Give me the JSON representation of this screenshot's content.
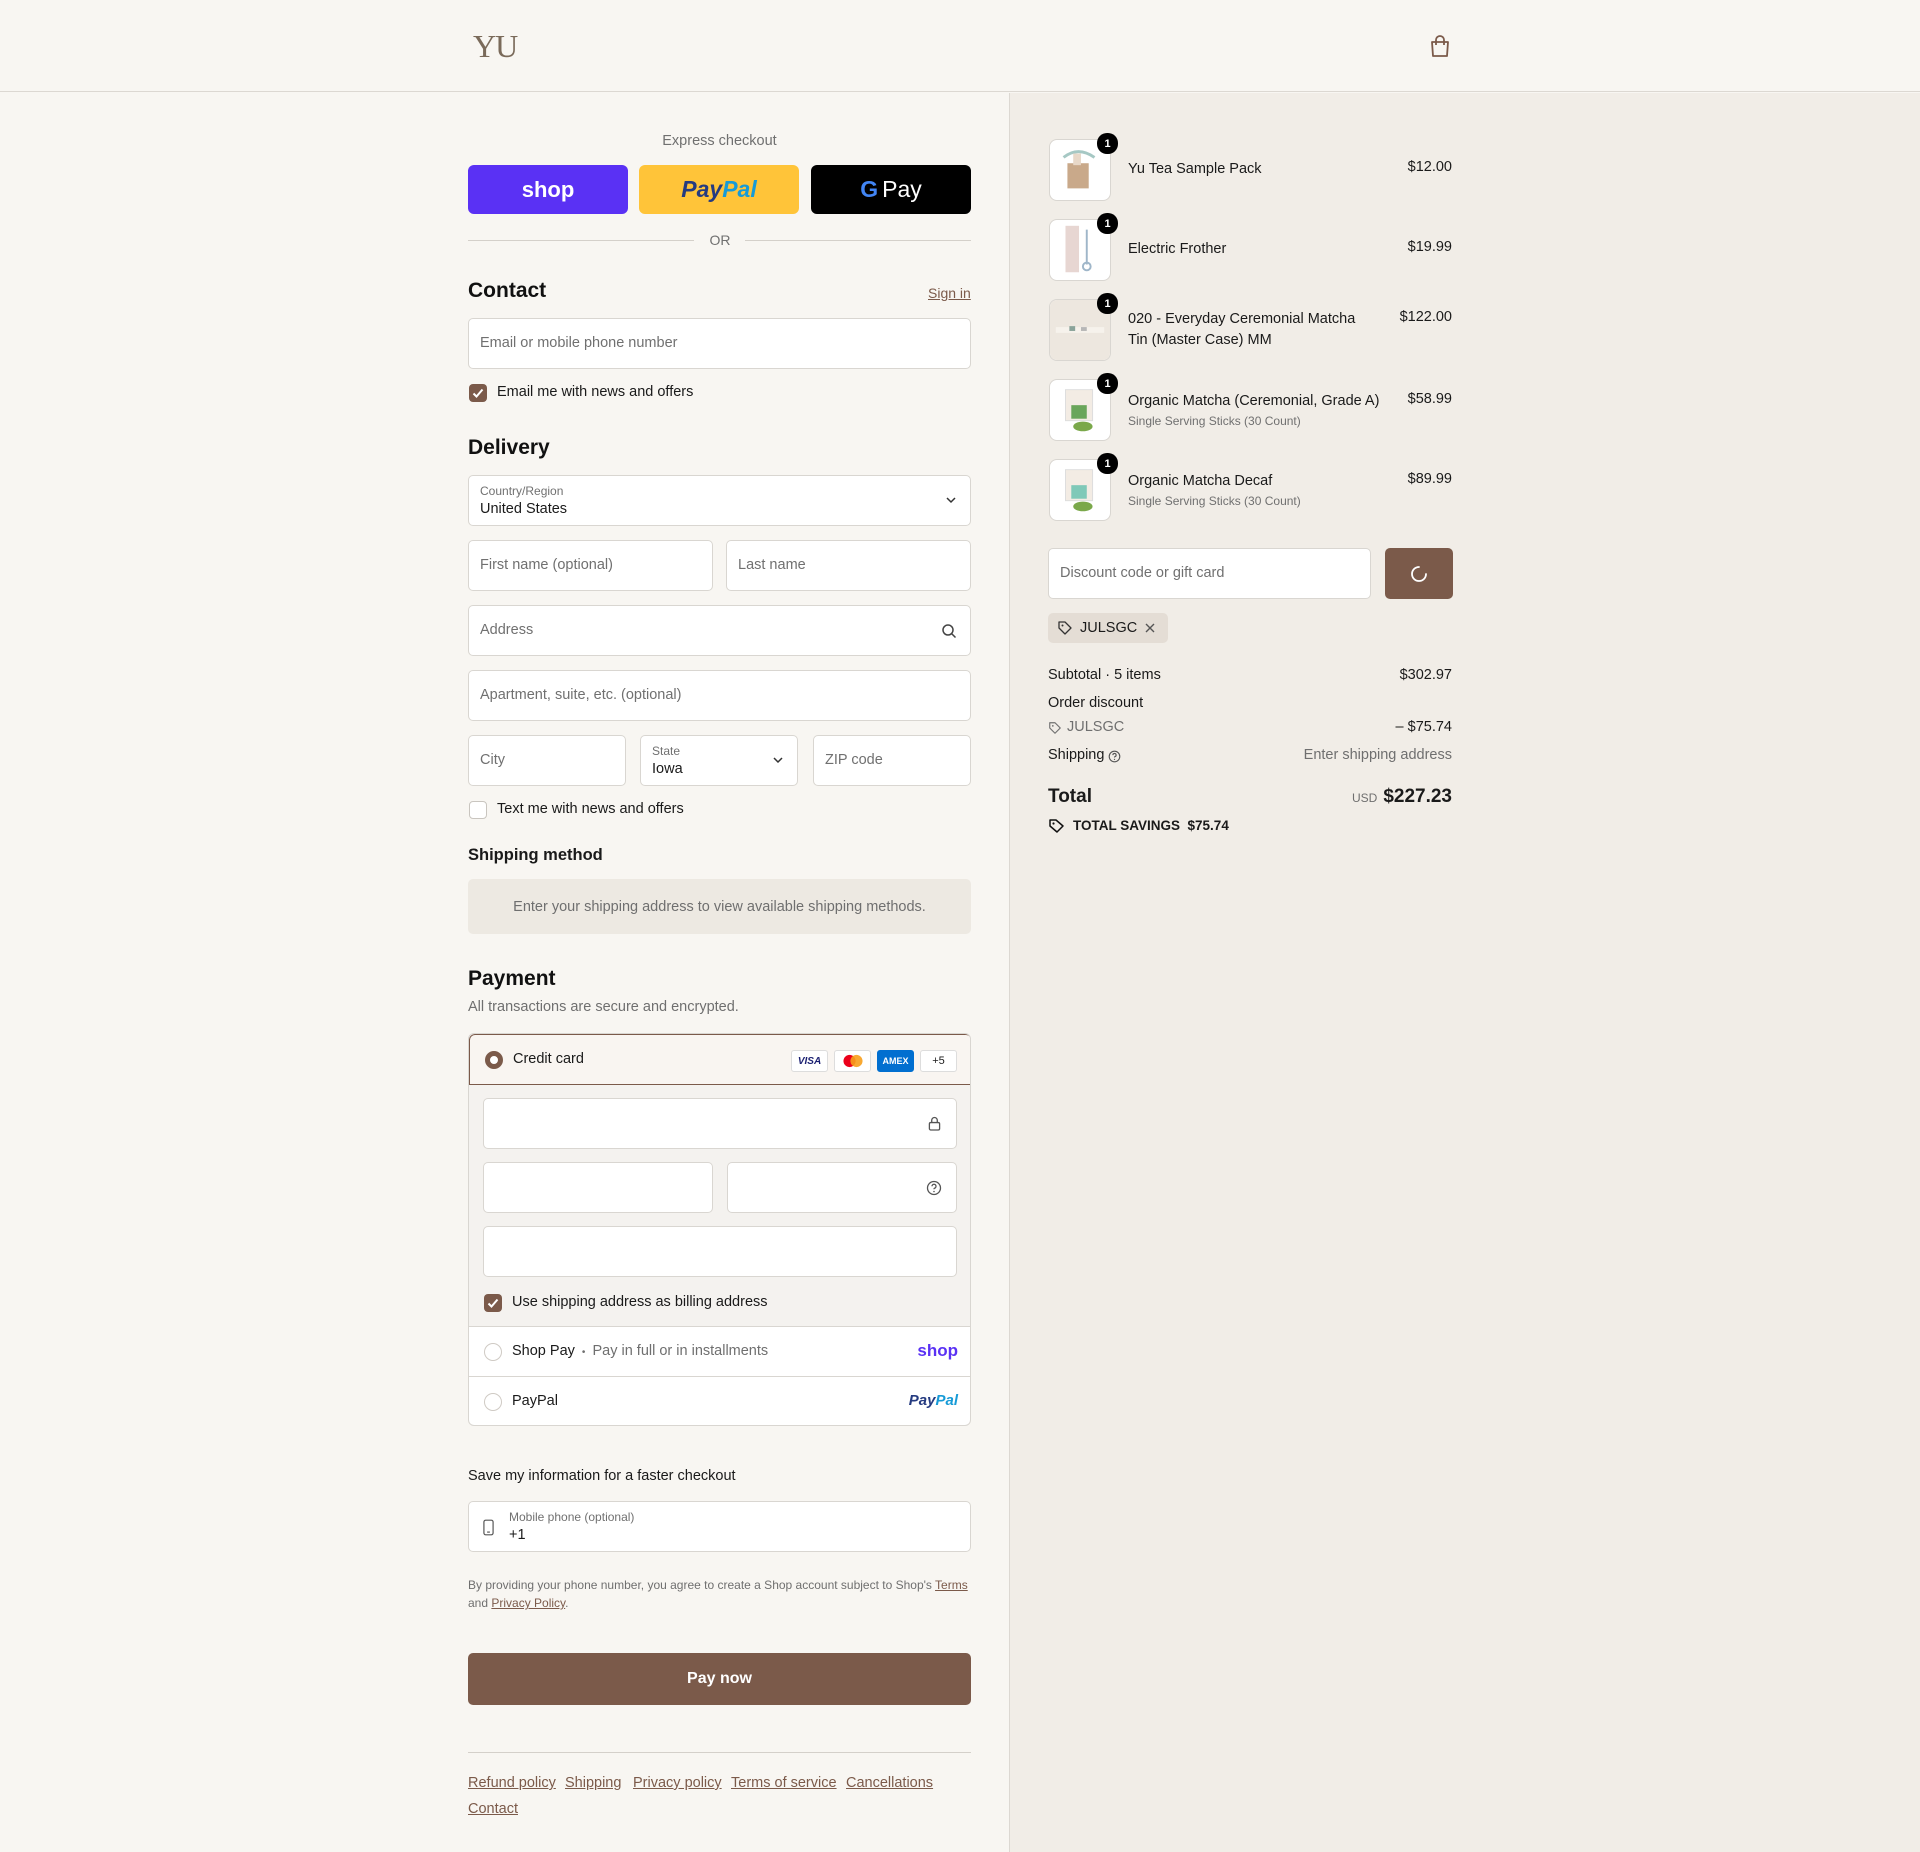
{
  "brand": {
    "logo": "YU"
  },
  "express": {
    "title": "Express checkout",
    "shop": "shop",
    "paypal_a": "Pay",
    "paypal_b": "Pal",
    "gpay_g": "G",
    "gpay_pay": "Pay",
    "or": "OR"
  },
  "contact": {
    "title": "Contact",
    "sign_in": "Sign in",
    "email_placeholder": "Email or mobile phone number",
    "news_label": "Email me with news and offers"
  },
  "delivery": {
    "title": "Delivery",
    "country_label": "Country/Region",
    "country_value": "United States",
    "first_name": "First name (optional)",
    "last_name": "Last name",
    "address": "Address",
    "apartment": "Apartment, suite, etc. (optional)",
    "city": "City",
    "state_label": "State",
    "state_value": "Iowa",
    "zip": "ZIP code",
    "text_news": "Text me with news and offers"
  },
  "shipping_method": {
    "title": "Shipping method",
    "notice": "Enter your shipping address to view available shipping methods."
  },
  "payment": {
    "title": "Payment",
    "subtitle": "All transactions are secure and encrypted.",
    "credit_card": "Credit card",
    "visa": "VISA",
    "amex": "AMEX",
    "more_cards": "+5",
    "billing_same": "Use shipping address as billing address",
    "shop_pay": "Shop Pay",
    "shop_pay_sep": "•",
    "shop_pay_desc": "Pay in full or in installments",
    "shop_logo": "shop",
    "paypal": "PayPal",
    "paypal_logo_a": "Pay",
    "paypal_logo_b": "Pal"
  },
  "save_info": {
    "title": "Save my information for a faster checkout",
    "phone_label": "Mobile phone (optional)",
    "phone_value": "+1",
    "legal_1": "By providing your phone number, you agree to create a Shop account subject to Shop's",
    "terms": "Terms",
    "legal_and": "and",
    "privacy": "Privacy Policy",
    "legal_end": "."
  },
  "pay_now": "Pay now",
  "footer_links": [
    "Refund policy",
    "Shipping",
    "Privacy policy",
    "Terms of service",
    "Cancellations",
    "Contact"
  ],
  "order": {
    "items": [
      {
        "name": "Yu Tea Sample Pack",
        "sub": "",
        "price": "$12.00",
        "qty": "1"
      },
      {
        "name": "Electric Frother",
        "sub": "",
        "price": "$19.99",
        "qty": "1"
      },
      {
        "name": "020 - Everyday Ceremonial Matcha Tin (Master Case) MM",
        "sub": "",
        "price": "$122.00",
        "qty": "1"
      },
      {
        "name": "Organic Matcha (Ceremonial, Grade A)",
        "sub": "Single Serving Sticks (30 Count)",
        "price": "$58.99",
        "qty": "1"
      },
      {
        "name": "Organic Matcha Decaf",
        "sub": "Single Serving Sticks (30 Count)",
        "price": "$89.99",
        "qty": "1"
      }
    ],
    "discount_placeholder": "Discount code or gift card",
    "applied_code": "JULSGC",
    "subtotal_label": "Subtotal · 5 items",
    "subtotal_value": "$302.97",
    "order_discount_label": "Order discount",
    "order_discount_code": "JULSGC",
    "order_discount_value": "– $75.74",
    "shipping_label": "Shipping",
    "shipping_value": "Enter shipping address",
    "total_label": "Total",
    "currency": "USD",
    "total_value": "$227.23",
    "savings_label": "TOTAL SAVINGS",
    "savings_value": "$75.74"
  },
  "colors": {
    "accent": "#7b5a4a",
    "shop_purple": "#5a31f4",
    "paypal_yellow": "#ffc439",
    "panel_bg": "#f1ede7",
    "page_bg": "#f8f6f2"
  }
}
